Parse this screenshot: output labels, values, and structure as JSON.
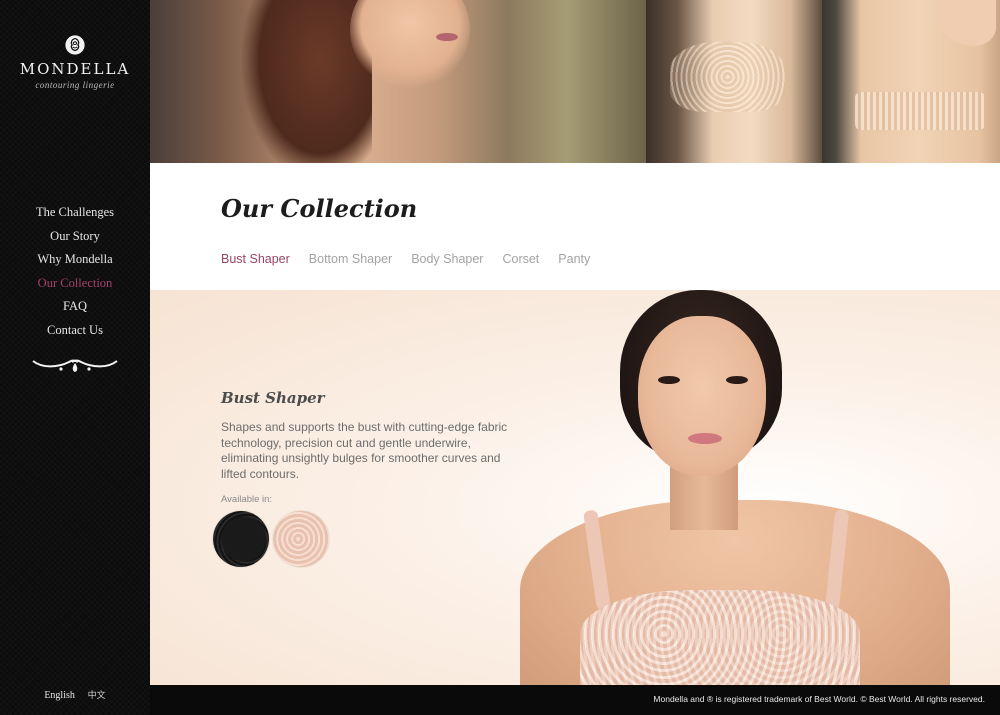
{
  "brand": {
    "name": "MONDELLA",
    "tagline": "contouring lingerie",
    "logo_icon": "rose-icon"
  },
  "nav": {
    "items": [
      {
        "label": "The Challenges",
        "active": false
      },
      {
        "label": "Our Story",
        "active": false
      },
      {
        "label": "Why Mondella",
        "active": false
      },
      {
        "label": "Our Collection",
        "active": true
      },
      {
        "label": "FAQ",
        "active": false
      },
      {
        "label": "Contact Us",
        "active": false
      }
    ]
  },
  "language": {
    "english": "English",
    "chinese": "中文"
  },
  "collection": {
    "title": "Our Collection",
    "tabs": [
      {
        "label": "Bust Shaper",
        "active": true
      },
      {
        "label": "Bottom Shaper",
        "active": false
      },
      {
        "label": "Body Shaper",
        "active": false
      },
      {
        "label": "Corset",
        "active": false
      },
      {
        "label": "Panty",
        "active": false
      }
    ]
  },
  "product": {
    "title": "Bust Shaper",
    "description": "Shapes and supports the bust with cutting-edge fabric technology, precision cut and gentle underwire, eliminating unsightly bulges for smoother curves and lifted contours.",
    "available_label": "Available in:",
    "colors": [
      "black",
      "nude"
    ]
  },
  "footer": {
    "text": "Mondella and ® is registered trademark of Best World. © Best World. All rights reserved."
  },
  "colors": {
    "accent": "#974466",
    "sidebar_bg": "#0c0c0c",
    "nav_active": "#a4416c"
  }
}
